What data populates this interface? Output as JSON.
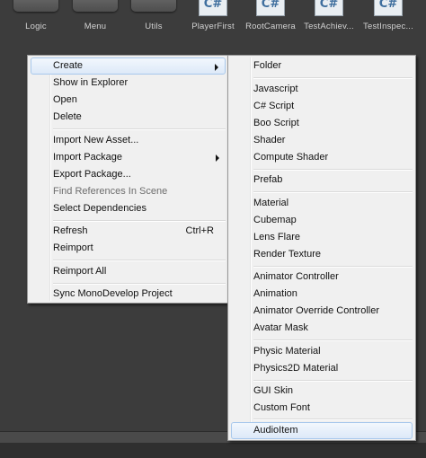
{
  "assets": [
    {
      "kind": "folder",
      "label": "Logic"
    },
    {
      "kind": "folder",
      "label": "Menu"
    },
    {
      "kind": "folder",
      "label": "Utils"
    },
    {
      "kind": "script",
      "label": "PlayerFirst",
      "badge": "C#"
    },
    {
      "kind": "script",
      "label": "RootCamera",
      "badge": "C#"
    },
    {
      "kind": "script",
      "label": "TestAchiev...",
      "badge": "C#"
    },
    {
      "kind": "script",
      "label": "TestInspec...",
      "badge": "C#"
    }
  ],
  "context_menu": {
    "items": [
      {
        "label": "Create",
        "submenu": true,
        "highlight": true
      },
      {
        "label": "Show in Explorer"
      },
      {
        "label": "Open"
      },
      {
        "label": "Delete"
      },
      {
        "label": "Import New Asset..."
      },
      {
        "label": "Import Package",
        "submenu": true
      },
      {
        "label": "Export Package..."
      },
      {
        "label": "Find References In Scene",
        "disabled": true
      },
      {
        "label": "Select Dependencies"
      },
      {
        "label": "Refresh",
        "shortcut": "Ctrl+R"
      },
      {
        "label": "Reimport"
      },
      {
        "label": "Reimport All"
      },
      {
        "label": "Sync MonoDevelop Project"
      }
    ]
  },
  "create_submenu": {
    "items": [
      {
        "label": "Folder"
      },
      {
        "label": "Javascript"
      },
      {
        "label": "C# Script"
      },
      {
        "label": "Boo Script"
      },
      {
        "label": "Shader"
      },
      {
        "label": "Compute Shader"
      },
      {
        "label": "Prefab"
      },
      {
        "label": "Material"
      },
      {
        "label": "Cubemap"
      },
      {
        "label": "Lens Flare"
      },
      {
        "label": "Render Texture"
      },
      {
        "label": "Animator Controller"
      },
      {
        "label": "Animation"
      },
      {
        "label": "Animator Override Controller"
      },
      {
        "label": "Avatar Mask"
      },
      {
        "label": "Physic Material"
      },
      {
        "label": "Physics2D Material"
      },
      {
        "label": "GUI Skin"
      },
      {
        "label": "Custom Font"
      },
      {
        "label": "AudioItem",
        "highlight": true
      }
    ]
  },
  "colors": {
    "background": "#3c3c3c",
    "menu_background": "#f0f0f0",
    "highlight_border": "#a8c8ec"
  }
}
